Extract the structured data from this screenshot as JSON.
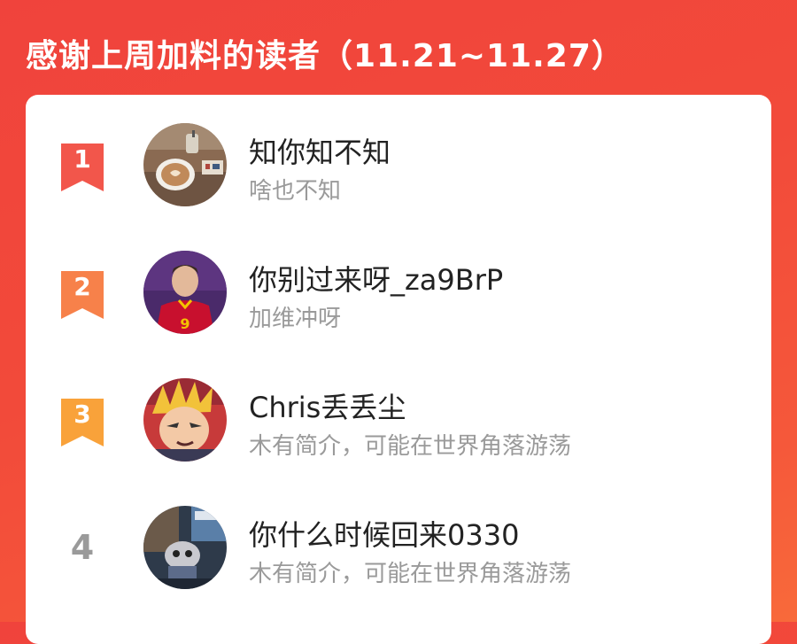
{
  "header": {
    "title": "感谢上周加料的读者（11.21~11.27）"
  },
  "readers": [
    {
      "rank": "1",
      "rank_color": "#f2564b",
      "rank_style": "ribbon",
      "name": "知你知不知",
      "bio": "啥也不知",
      "avatar_icon": "coffee-cup-photo"
    },
    {
      "rank": "2",
      "rank_color": "#f7814a",
      "rank_style": "ribbon",
      "name": "你别过来呀_za9BrP",
      "bio": "加维冲呀",
      "avatar_icon": "footballer-photo"
    },
    {
      "rank": "3",
      "rank_color": "#f9a23a",
      "rank_style": "ribbon",
      "name": "Chris丢丢尘",
      "bio": "木有简介，可能在世界角落游荡",
      "avatar_icon": "anime-character-avatar"
    },
    {
      "rank": "4",
      "rank_color": "#9a9a9a",
      "rank_style": "plain",
      "name": "你什么时候回来0330",
      "bio": "木有简介，可能在世界角落游荡",
      "avatar_icon": "figurine-photo"
    }
  ]
}
